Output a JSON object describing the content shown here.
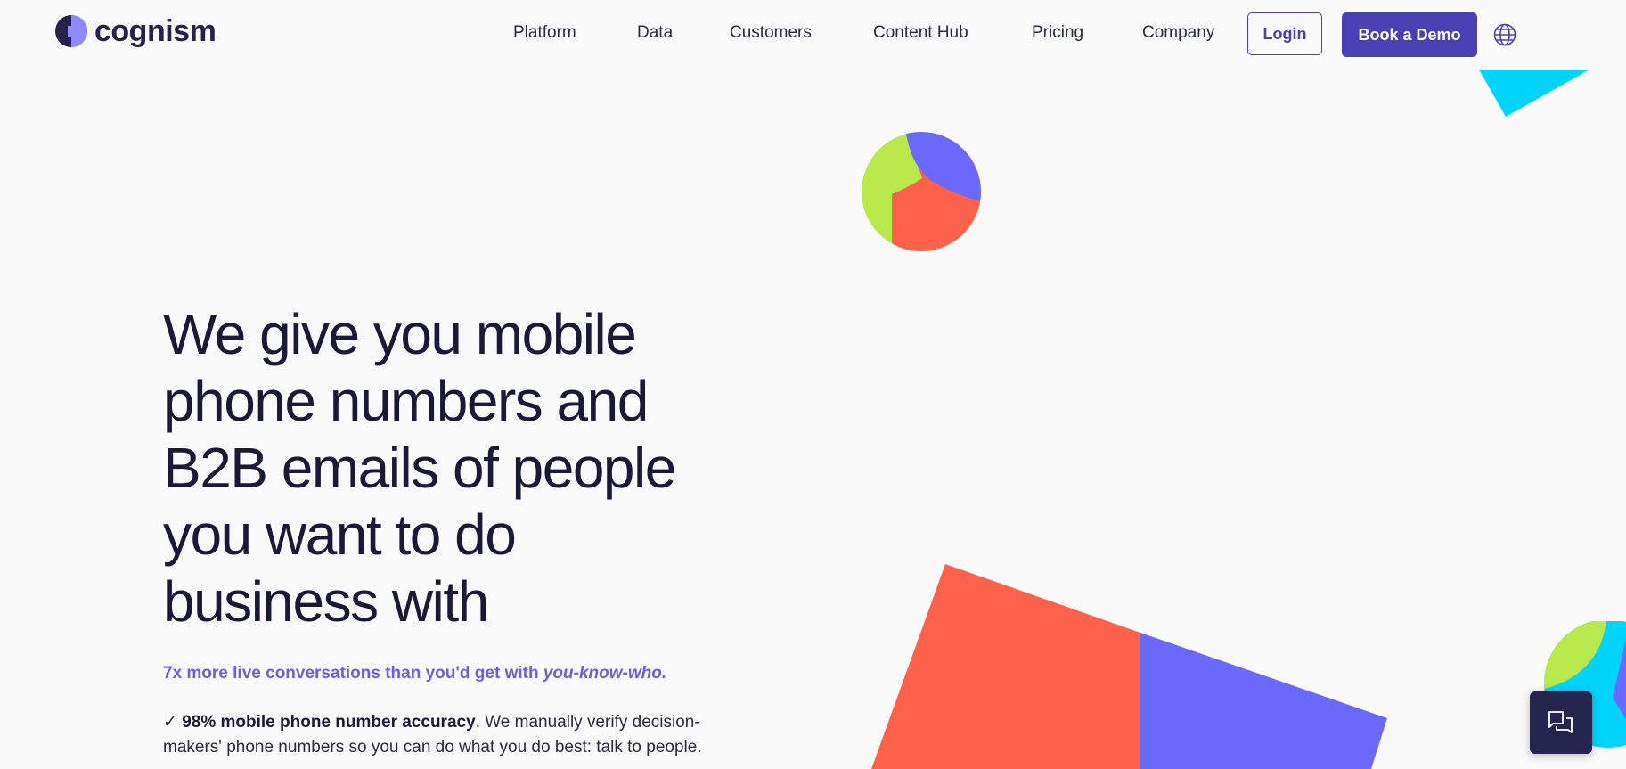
{
  "brand": {
    "name": "cognism",
    "colors": {
      "primary": "#4b3fb6",
      "dark": "#25234a",
      "accent_purple": "#6b69fc",
      "accent_coral": "#ff624a",
      "accent_lime": "#b8e84a",
      "accent_cyan": "#00d4fa"
    }
  },
  "nav": {
    "items": [
      {
        "label": "Platform"
      },
      {
        "label": "Data"
      },
      {
        "label": "Customers"
      },
      {
        "label": "Content Hub"
      },
      {
        "label": "Pricing"
      },
      {
        "label": "Company"
      }
    ],
    "login_label": "Login",
    "demo_label": "Book a Demo",
    "language_icon": "globe-icon"
  },
  "hero": {
    "title": "We give you mobile phone numbers and B2B emails of people you want to do business with",
    "tagline_main": "7x more live conversations than you'd get with ",
    "tagline_em": "you-know-who.",
    "bullet_check": "✓",
    "bullet_bold": "98% mobile phone number accuracy",
    "bullet_rest": ". We manually verify decision-makers' phone numbers so you can do what you do best: talk to people."
  },
  "chat": {
    "icon": "chat-bubbles-icon"
  }
}
